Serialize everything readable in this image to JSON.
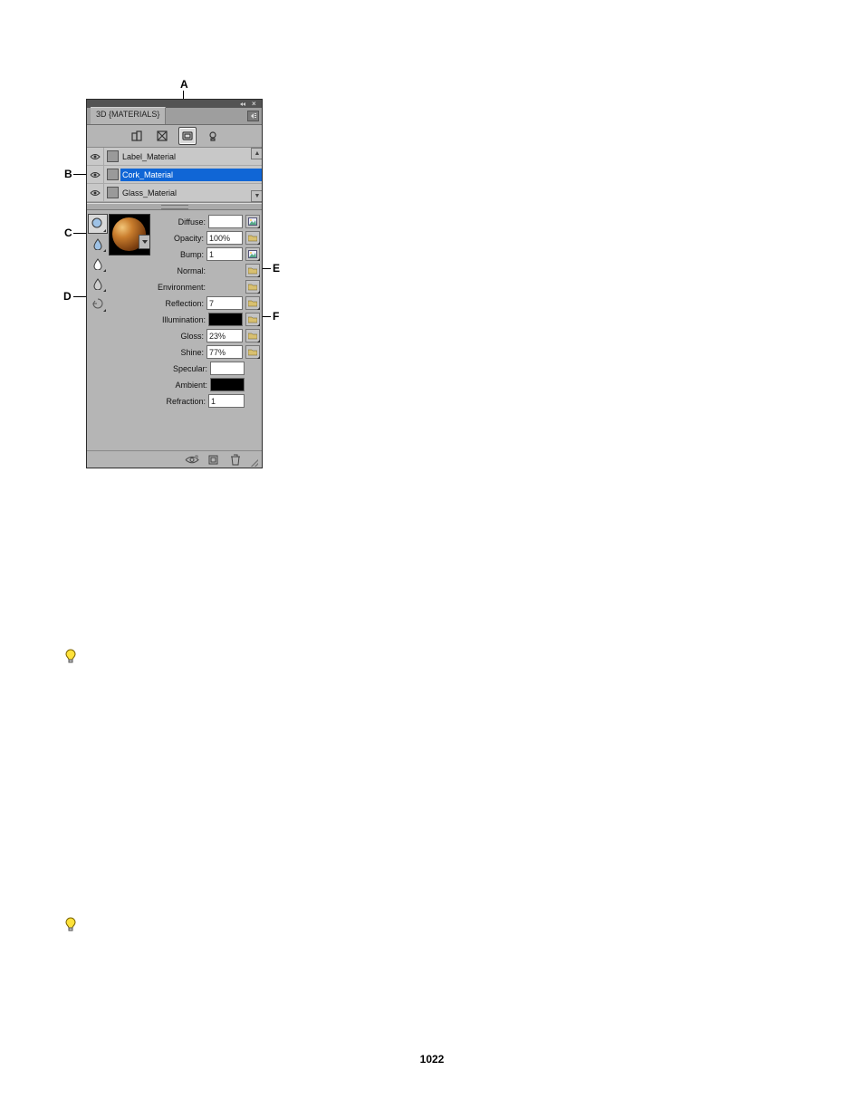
{
  "panel": {
    "title": "3D {MATERIALS}",
    "sectionTabs": [
      "scene",
      "mesh",
      "materials",
      "lights"
    ],
    "materials": [
      {
        "name": "Label_Material",
        "selected": false
      },
      {
        "name": "Cork_Material",
        "selected": true
      },
      {
        "name": "Glass_Material",
        "selected": false
      }
    ],
    "properties": {
      "Diffuse": {
        "type": "swatch",
        "color": "#ffffff",
        "menu": "image"
      },
      "Opacity": {
        "type": "value",
        "value": "100%",
        "menu": "folder"
      },
      "Bump": {
        "type": "value",
        "value": "1",
        "menu": "image"
      },
      "Normal": {
        "type": "none",
        "menu": "folder"
      },
      "Environment": {
        "type": "none",
        "menu": "folder"
      },
      "Reflection": {
        "type": "value",
        "value": "7",
        "menu": "folder"
      },
      "Illumination": {
        "type": "swatch",
        "color": "#000000",
        "menu": "folder"
      },
      "Gloss": {
        "type": "value",
        "value": "23%",
        "menu": "folder"
      },
      "Shine": {
        "type": "value",
        "value": "77%",
        "menu": "folder"
      },
      "Specular": {
        "type": "swatch",
        "color": "#ffffff",
        "menu": null
      },
      "Ambient": {
        "type": "swatch",
        "color": "#000000",
        "menu": null
      },
      "Refraction": {
        "type": "value",
        "value": "1",
        "menu": null
      }
    }
  },
  "callouts": {
    "A": "A",
    "B": "B",
    "C": "C",
    "D": "D",
    "E": "E",
    "F": "F"
  },
  "page_number": "1022"
}
